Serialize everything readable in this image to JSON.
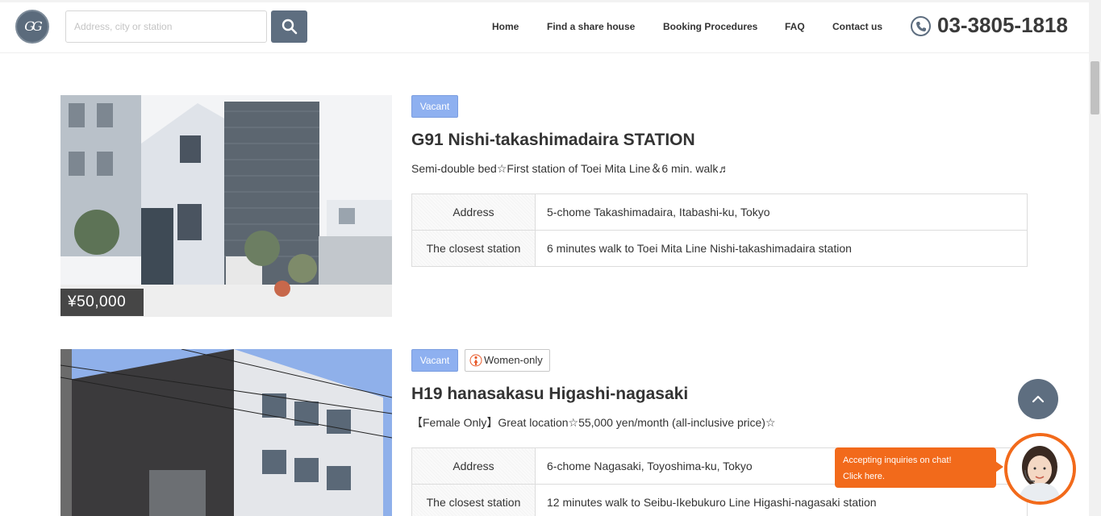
{
  "header": {
    "logo_text": "GG",
    "search_placeholder": "Address, city or station",
    "nav": [
      "Home",
      "Find a share house",
      "Booking Procedures",
      "FAQ",
      "Contact us"
    ],
    "phone": "03-3805-1818"
  },
  "listings": [
    {
      "price": "¥50,000",
      "badges": {
        "vacant": "Vacant"
      },
      "title": "G91 Nishi-takashimadaira STATION",
      "subtitle": "Semi-double bed☆First station of Toei Mita Line＆6 min. walk♬",
      "rows": [
        {
          "label": "Address",
          "value": "5-chome Takashimadaira, Itabashi-ku, Tokyo"
        },
        {
          "label": "The closest station",
          "value": "6 minutes walk to Toei Mita Line Nishi-takashimadaira station"
        }
      ]
    },
    {
      "badges": {
        "vacant": "Vacant",
        "women": "Women-only"
      },
      "title": "H19 hanasakasu Higashi-nagasaki",
      "subtitle": "【Female Only】Great location☆55,000 yen/month (all-inclusive price)☆",
      "rows": [
        {
          "label": "Address",
          "value": "6-chome Nagasaki, Toyoshima-ku, Tokyo"
        },
        {
          "label": "The closest station",
          "value": "12 minutes walk to Seibu-Ikebukuro Line Higashi-nagasaki station"
        }
      ]
    }
  ],
  "chat": {
    "line1": "Accepting inquiries on chat!",
    "line2": "Click here."
  },
  "colors": {
    "accent": "#5e6e80",
    "vacant": "#8eb0f0",
    "chat": "#f26a1b"
  }
}
